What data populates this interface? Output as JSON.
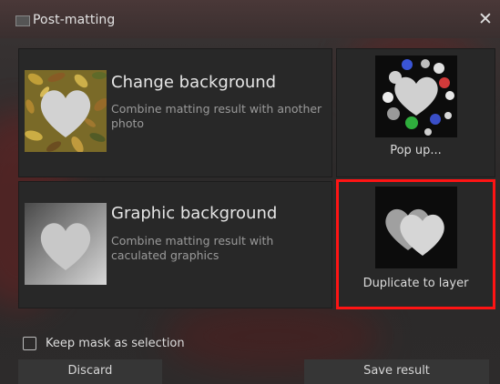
{
  "window": {
    "title": "Post-matting",
    "close_glyph": "✕"
  },
  "options": [
    {
      "title": "Change background",
      "description": "Combine matting result with another photo",
      "thumb": "leaves-heart"
    },
    {
      "title": "Graphic background",
      "description": "Combine matting result with caculated graphics",
      "thumb": "gradient-heart"
    }
  ],
  "tiles": [
    {
      "label": "Pop up...",
      "thumb": "bubbles-heart"
    },
    {
      "label": "Duplicate to layer",
      "thumb": "double-heart",
      "highlighted": true
    }
  ],
  "footer": {
    "keep_mask_label": "Keep mask as selection",
    "keep_mask_checked": false,
    "discard_label": "Discard",
    "save_label": "Save result"
  },
  "colors": {
    "highlight": "#ff1414",
    "panel": "#282828"
  }
}
